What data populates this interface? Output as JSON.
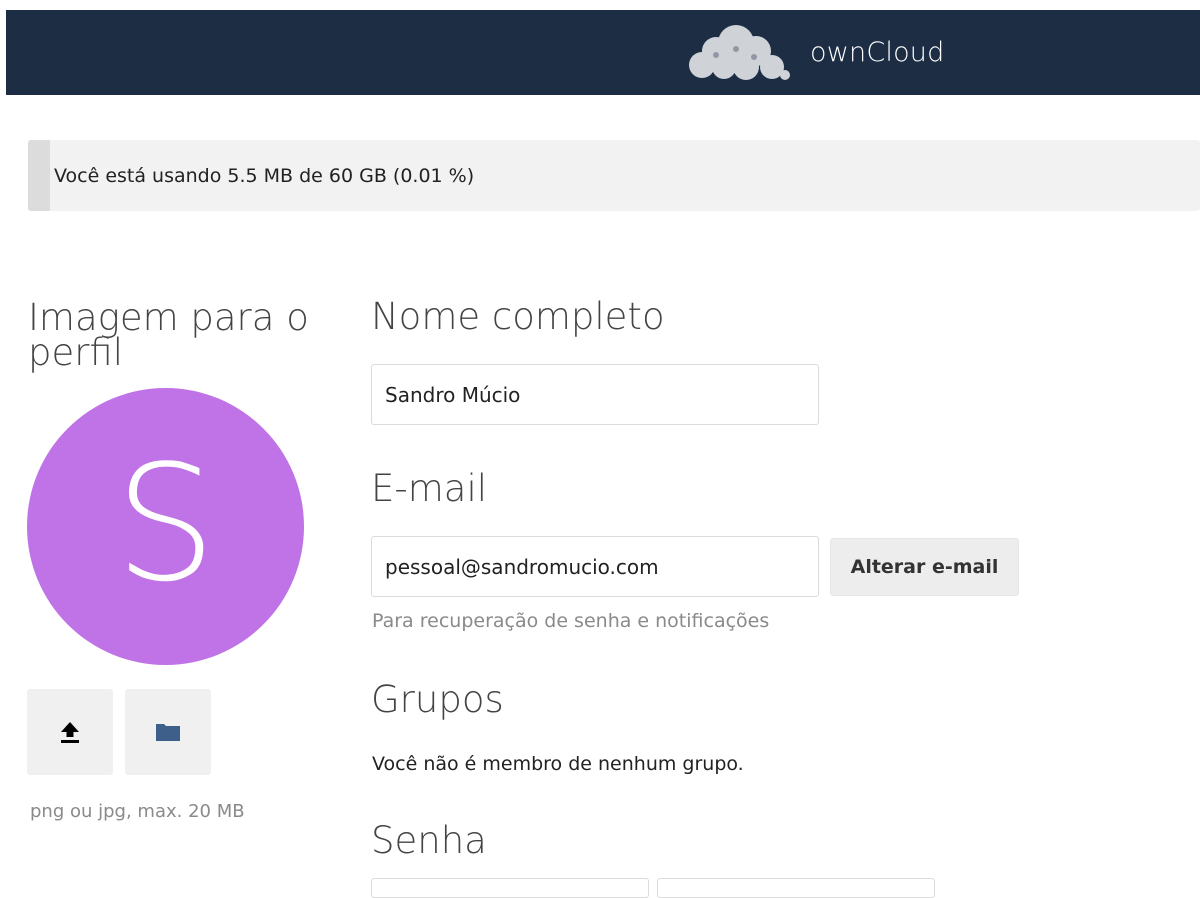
{
  "header": {
    "brand_name": "ownCloud",
    "logo_icon": "owncloud-cloud-icon",
    "background_color": "#1d2d44"
  },
  "quota": {
    "text": "Você está usando 5.5 MB de 60 GB (0.01 %)",
    "used_fraction": 0.0001
  },
  "profile_picture": {
    "title_line1": "Imagem para o",
    "title_line2": "perfil",
    "avatar_letter": "S",
    "avatar_color": "#c073e6",
    "upload_icon": "upload-icon",
    "folder_icon": "folder-icon",
    "hint": "png ou jpg, max. 20 MB"
  },
  "full_name": {
    "title": "Nome completo",
    "value": "Sandro Múcio"
  },
  "email": {
    "title": "E-mail",
    "value": "pessoal@sandromucio.com",
    "change_button": "Alterar e-mail",
    "hint": "Para recuperação de senha e notificações"
  },
  "groups": {
    "title": "Grupos",
    "text": "Você não é membro de nenhum grupo."
  },
  "password": {
    "title": "Senha"
  }
}
